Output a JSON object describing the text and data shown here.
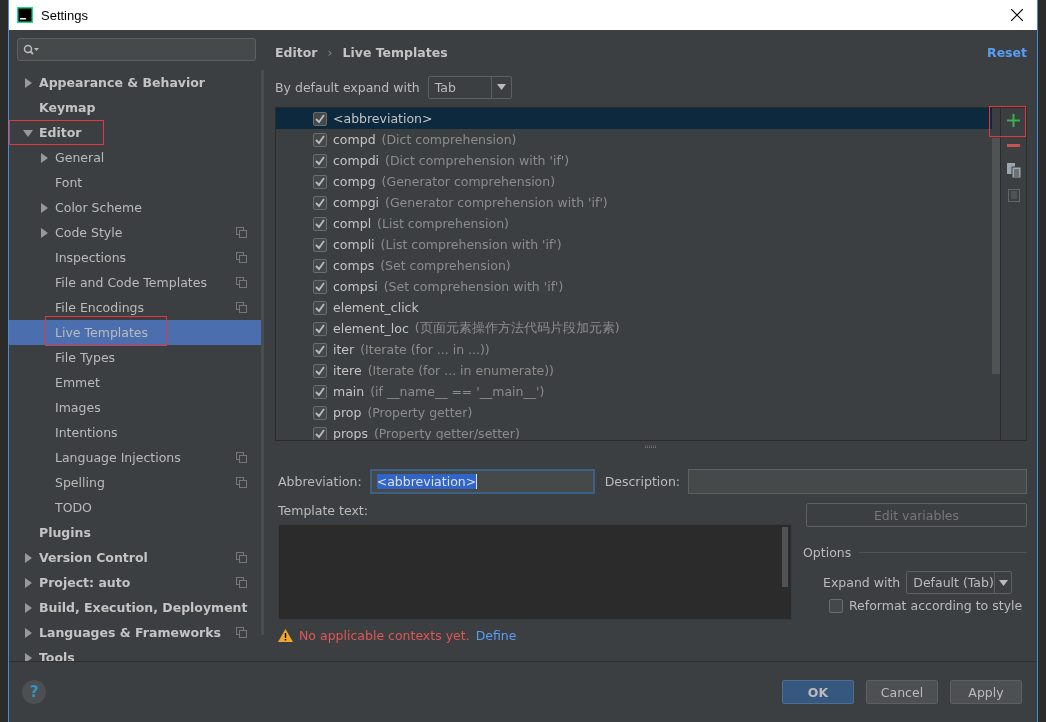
{
  "window": {
    "title": "Settings"
  },
  "help_button": "?",
  "tree": [
    {
      "label": "Appearance & Behavior",
      "bold": true,
      "expanded": false,
      "project_level": false,
      "selected": false,
      "annotated": false
    },
    {
      "label": "Keymap",
      "bold": true,
      "project_level": false,
      "selected": false,
      "annotated": false
    },
    {
      "label": "Editor",
      "bold": true,
      "expanded": true,
      "project_level": false,
      "selected": false,
      "annotated": true,
      "children": [
        {
          "label": "General",
          "bold": false,
          "expanded": false,
          "project_level": false,
          "selected": false,
          "annotated": false
        },
        {
          "label": "Font",
          "bold": false,
          "project_level": false,
          "selected": false,
          "annotated": false
        },
        {
          "label": "Color Scheme",
          "bold": false,
          "expanded": false,
          "project_level": false,
          "selected": false,
          "annotated": false
        },
        {
          "label": "Code Style",
          "bold": false,
          "expanded": false,
          "project_level": true,
          "selected": false,
          "annotated": false
        },
        {
          "label": "Inspections",
          "bold": false,
          "project_level": true,
          "selected": false,
          "annotated": false
        },
        {
          "label": "File and Code Templates",
          "bold": false,
          "project_level": true,
          "selected": false,
          "annotated": false
        },
        {
          "label": "File Encodings",
          "bold": false,
          "project_level": true,
          "selected": false,
          "annotated": false
        },
        {
          "label": "Live Templates",
          "bold": false,
          "project_level": false,
          "selected": true,
          "annotated": true
        },
        {
          "label": "File Types",
          "bold": false,
          "project_level": false,
          "selected": false,
          "annotated": false
        },
        {
          "label": "Emmet",
          "bold": false,
          "project_level": false,
          "selected": false,
          "annotated": false
        },
        {
          "label": "Images",
          "bold": false,
          "project_level": false,
          "selected": false,
          "annotated": false
        },
        {
          "label": "Intentions",
          "bold": false,
          "project_level": false,
          "selected": false,
          "annotated": false
        },
        {
          "label": "Language Injections",
          "bold": false,
          "project_level": true,
          "selected": false,
          "annotated": false
        },
        {
          "label": "Spelling",
          "bold": false,
          "project_level": true,
          "selected": false,
          "annotated": false
        },
        {
          "label": "TODO",
          "bold": false,
          "project_level": false,
          "selected": false,
          "annotated": false
        }
      ]
    },
    {
      "label": "Plugins",
      "bold": true,
      "project_level": false,
      "selected": false,
      "annotated": false
    },
    {
      "label": "Version Control",
      "bold": true,
      "expanded": false,
      "project_level": true,
      "selected": false,
      "annotated": false
    },
    {
      "label": "Project: auto",
      "bold": true,
      "expanded": false,
      "project_level": true,
      "selected": false,
      "annotated": false
    },
    {
      "label": "Build, Execution, Deployment",
      "bold": true,
      "expanded": false,
      "project_level": false,
      "selected": false,
      "annotated": false
    },
    {
      "label": "Languages & Frameworks",
      "bold": true,
      "expanded": false,
      "project_level": true,
      "selected": false,
      "annotated": false
    },
    {
      "label": "Tools",
      "bold": true,
      "expanded": false,
      "project_level": false,
      "selected": false,
      "annotated": false
    }
  ],
  "breadcrumb": [
    "Editor",
    "Live Templates"
  ],
  "breadcrumb_separator": "›",
  "reset_link": "Reset",
  "expand_default": {
    "label": "By default expand with",
    "value": "Tab"
  },
  "templates": [
    {
      "name": "<abbreviation>",
      "checked": true,
      "selected": true
    },
    {
      "name": "compd",
      "description": "(Dict comprehension)",
      "checked": true,
      "selected": false
    },
    {
      "name": "compdi",
      "description": "(Dict comprehension with 'if')",
      "checked": true,
      "selected": false
    },
    {
      "name": "compg",
      "description": "(Generator comprehension)",
      "checked": true,
      "selected": false
    },
    {
      "name": "compgi",
      "description": "(Generator comprehension with 'if')",
      "checked": true,
      "selected": false
    },
    {
      "name": "compl",
      "description": "(List comprehension)",
      "checked": true,
      "selected": false
    },
    {
      "name": "compli",
      "description": "(List comprehension with 'if')",
      "checked": true,
      "selected": false
    },
    {
      "name": "comps",
      "description": "(Set comprehension)",
      "checked": true,
      "selected": false
    },
    {
      "name": "compsi",
      "description": "(Set comprehension with 'if')",
      "checked": true,
      "selected": false
    },
    {
      "name": "element_click",
      "checked": true,
      "selected": false
    },
    {
      "name": "element_loc",
      "description": "(页面元素操作方法代码片段加元素)",
      "checked": true,
      "selected": false
    },
    {
      "name": "iter",
      "description": "(Iterate (for ... in ...))",
      "checked": true,
      "selected": false
    },
    {
      "name": "itere",
      "description": "(Iterate (for ... in enumerate))",
      "checked": true,
      "selected": false
    },
    {
      "name": "main",
      "description": "(if __name__ == '__main__')",
      "checked": true,
      "selected": false
    },
    {
      "name": "prop",
      "description": "(Property getter)",
      "checked": true,
      "selected": false
    },
    {
      "name": "props",
      "description": "(Property getter/setter)",
      "checked": true,
      "selected": false
    }
  ],
  "toolbar": [
    {
      "kind": "add",
      "annotated": true,
      "disabled": false
    },
    {
      "kind": "remove",
      "annotated": false,
      "disabled": false
    },
    {
      "kind": "copy",
      "annotated": false,
      "disabled": false
    },
    {
      "kind": "edit",
      "annotated": false,
      "disabled": true
    }
  ],
  "abbreviation": {
    "label": "Abbreviation:",
    "value": "<abbreviation>"
  },
  "description": {
    "label": "Description:"
  },
  "template_text": {
    "label": "Template text:"
  },
  "edit_variables": {
    "label": "Edit variables",
    "disabled": true
  },
  "options": {
    "title": "Options",
    "expand_label": "Expand with",
    "expand_value": "Default (Tab)",
    "reformat": {
      "label": "Reformat according to style",
      "checked": false
    }
  },
  "warning": {
    "text": "No applicable contexts yet.",
    "link": "Define"
  },
  "buttons": [
    {
      "label": "OK",
      "primary": true
    },
    {
      "label": "Cancel",
      "primary": false
    },
    {
      "label": "Apply",
      "primary": false
    }
  ]
}
